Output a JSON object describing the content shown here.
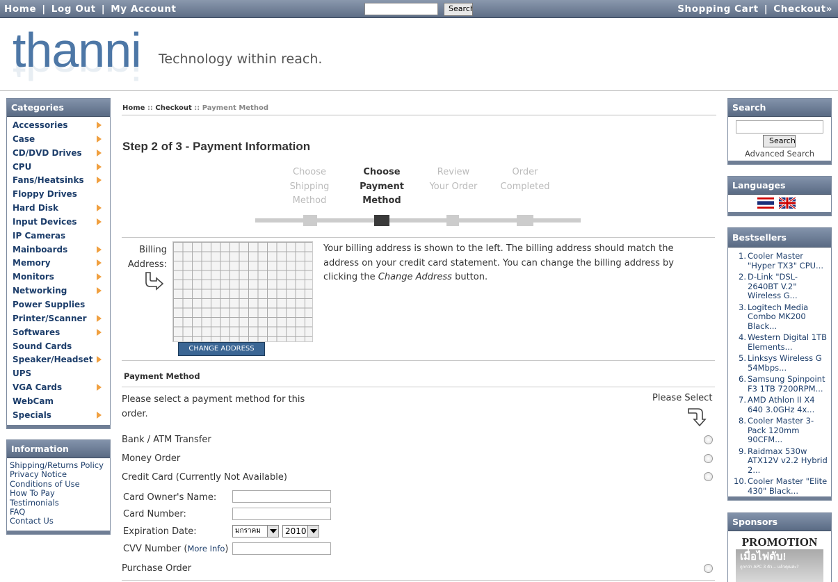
{
  "topnav": {
    "home": "Home",
    "logout": "Log Out",
    "account": "My Account",
    "search_button": "Search",
    "cart": "Shopping Cart",
    "checkout": "Checkout»"
  },
  "header": {
    "logo": "thanni",
    "tagline": "Technology within reach."
  },
  "categories": {
    "title": "Categories",
    "items": [
      {
        "label": "Accessories",
        "arrow": true
      },
      {
        "label": "Case",
        "arrow": true
      },
      {
        "label": "CD/DVD Drives",
        "arrow": true
      },
      {
        "label": "CPU",
        "arrow": true
      },
      {
        "label": "Fans/Heatsinks",
        "arrow": true
      },
      {
        "label": "Floppy Drives",
        "arrow": false
      },
      {
        "label": "Hard Disk",
        "arrow": true
      },
      {
        "label": "Input Devices",
        "arrow": true
      },
      {
        "label": "IP Cameras",
        "arrow": false
      },
      {
        "label": "Mainboards",
        "arrow": true
      },
      {
        "label": "Memory",
        "arrow": true
      },
      {
        "label": "Monitors",
        "arrow": true
      },
      {
        "label": "Networking",
        "arrow": true
      },
      {
        "label": "Power Supplies",
        "arrow": false
      },
      {
        "label": "Printer/Scanner",
        "arrow": true
      },
      {
        "label": "Softwares",
        "arrow": true
      },
      {
        "label": "Sound Cards",
        "arrow": false
      },
      {
        "label": "Speaker/Headset",
        "arrow": true
      },
      {
        "label": "UPS",
        "arrow": false
      },
      {
        "label": "VGA Cards",
        "arrow": true
      },
      {
        "label": "WebCam",
        "arrow": false
      },
      {
        "label": "Specials",
        "arrow": true
      }
    ]
  },
  "information": {
    "title": "Information",
    "items": [
      "Shipping/Returns Policy",
      "Privacy Notice",
      "Conditions of Use",
      "How To Pay",
      "Testimonials",
      "FAQ",
      "Contact Us"
    ]
  },
  "breadcrumb": {
    "home": "Home",
    "checkout": "Checkout",
    "current": "Payment Method",
    "sep": "::"
  },
  "main": {
    "step_title": "Step 2 of 3 - Payment Information",
    "steps": [
      {
        "lines": [
          "Choose",
          "Shipping",
          "Method"
        ],
        "active": false
      },
      {
        "lines": [
          "Choose",
          "Payment",
          "Method"
        ],
        "active": true
      },
      {
        "lines": [
          "Review",
          "Your Order"
        ],
        "active": false
      },
      {
        "lines": [
          "Order",
          "Completed"
        ],
        "active": false
      }
    ],
    "billing_label_1": "Billing",
    "billing_label_2": "Address:",
    "change_address": "CHANGE ADDRESS",
    "billing_text_1": "Your billing address is shown to the left. The billing address should match the address on your credit card statement. You can change the billing address by clicking the ",
    "billing_text_em": "Change Address",
    "billing_text_2": " button.",
    "payment_title": "Payment Method",
    "payment_desc": "Please select a payment method for this order.",
    "please_select": "Please Select",
    "methods": [
      "Bank / ATM Transfer",
      "Money Order",
      "Credit Card (Currently Not Available)",
      "Purchase Order"
    ],
    "cc_owner": "Card Owner's Name:",
    "cc_number": "Card Number:",
    "cc_expiration": "Expiration Date:",
    "cc_month": "มกราคม",
    "cc_year": "2010",
    "cc_cvv": "CVV Number",
    "cc_more_info": "More Info"
  },
  "search_box": {
    "title": "Search",
    "button": "Search",
    "advanced": "Advanced Search"
  },
  "languages": {
    "title": "Languages"
  },
  "bestsellers": {
    "title": "Bestsellers",
    "items": [
      "Cooler Master \"Hyper TX3\" CPU...",
      "D-Link \"DSL-2640BT V.2\" Wireless G...",
      "Logitech Media Combo MK200 Black...",
      "Western Digital 1TB Elements...",
      "Linksys Wireless G 54Mbps...",
      "Samsung Spinpoint F3 1TB 7200RPM...",
      "AMD Athlon II X4 640 3.0GHz 4x...",
      "Cooler Master 3-Pack 120mm 90CFM...",
      "Raidmax 530w ATX12V v2.2 Hybrid 2...",
      "Cooler Master \"Elite 430\" Black..."
    ]
  },
  "sponsors": {
    "title": "Sponsors",
    "promo": "PROMOTION",
    "promo_thai": "เมื่อไฟดับ!",
    "promo_small": "ถูกกว่า APC 3 ตัว... แล้วคุณล่ะ?"
  }
}
